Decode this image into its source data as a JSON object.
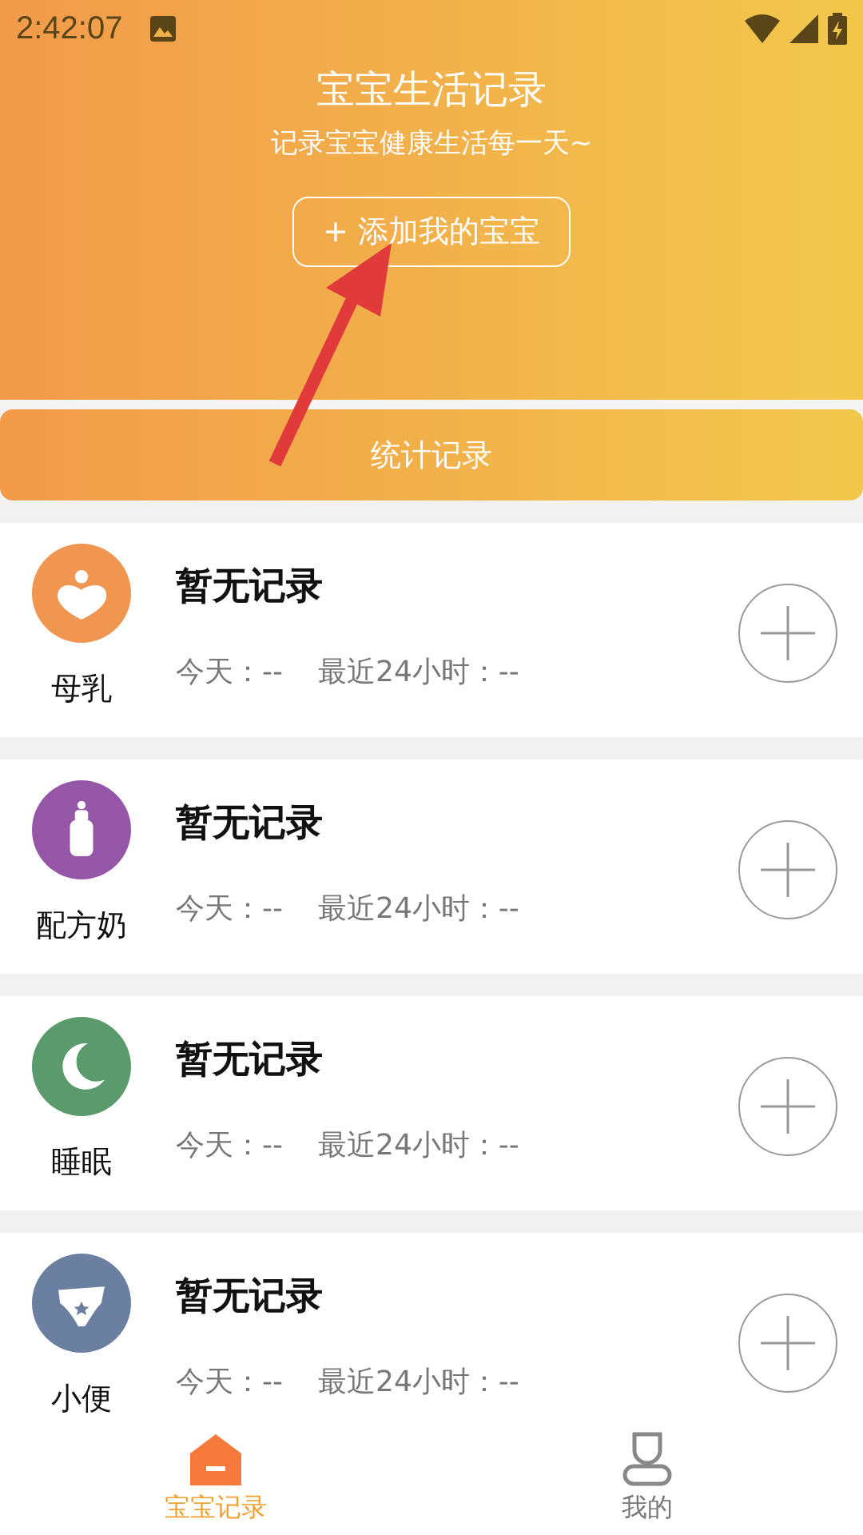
{
  "status_bar": {
    "time": "2:42:07"
  },
  "header": {
    "title": "宝宝生活记录",
    "subtitle": "记录宝宝健康生活每一天~",
    "add_button": "+ 添加我的宝宝"
  },
  "stats_button": "统计记录",
  "records": [
    {
      "kind": "breastmilk",
      "color": "#f09650",
      "name": "母乳",
      "status": "暂无记录",
      "today": "今天：--",
      "last24": "最近24小时：--"
    },
    {
      "kind": "formula",
      "color": "#9556a8",
      "name": "配方奶",
      "status": "暂无记录",
      "today": "今天：--",
      "last24": "最近24小时：--"
    },
    {
      "kind": "sleep",
      "color": "#5a9a6c",
      "name": "睡眠",
      "status": "暂无记录",
      "today": "今天：--",
      "last24": "最近24小时：--"
    },
    {
      "kind": "diaper",
      "color": "#6b7fa0",
      "name": "小便",
      "status": "暂无记录",
      "today": "今天：--",
      "last24": "最近24小时：--"
    }
  ],
  "tabs": [
    {
      "kind": "home",
      "label": "宝宝记录",
      "selected": true
    },
    {
      "kind": "profile",
      "label": "我的",
      "selected": false
    }
  ]
}
